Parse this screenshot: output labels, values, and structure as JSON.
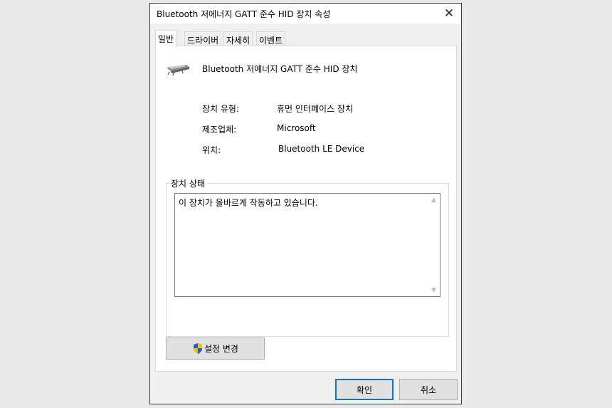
{
  "window": {
    "title": "Bluetooth 저에너지 GATT 준수 HID 장치 속성",
    "close_glyph": "✕"
  },
  "tabs": [
    {
      "label": "일반",
      "active": true
    },
    {
      "label": "드라이버",
      "active": false
    },
    {
      "label": "자세히",
      "active": false
    },
    {
      "label": "이벤트",
      "active": false
    }
  ],
  "general": {
    "device_name": "Bluetooth 저에너지 GATT 준수 HID 장치",
    "device_icon": "hid-device-icon",
    "properties": [
      {
        "label": "장치 유형:",
        "value": "휴먼 인터페이스 장치"
      },
      {
        "label": "제조업체:",
        "value": "Microsoft"
      },
      {
        "label": "위치:",
        "value": "Bluetooth LE Device"
      }
    ],
    "status_group_label": "장치 상태",
    "status_text": "이 장치가 올바르게 작동하고 있습니다.",
    "change_settings_label": "설정 변경"
  },
  "buttons": {
    "ok_label": "확인",
    "cancel_label": "취소"
  },
  "colors": {
    "accent": "#0078d7",
    "button_face": "#e1e1e1",
    "panel_bg": "#ffffff",
    "dialog_bg": "#f0f0f0"
  }
}
